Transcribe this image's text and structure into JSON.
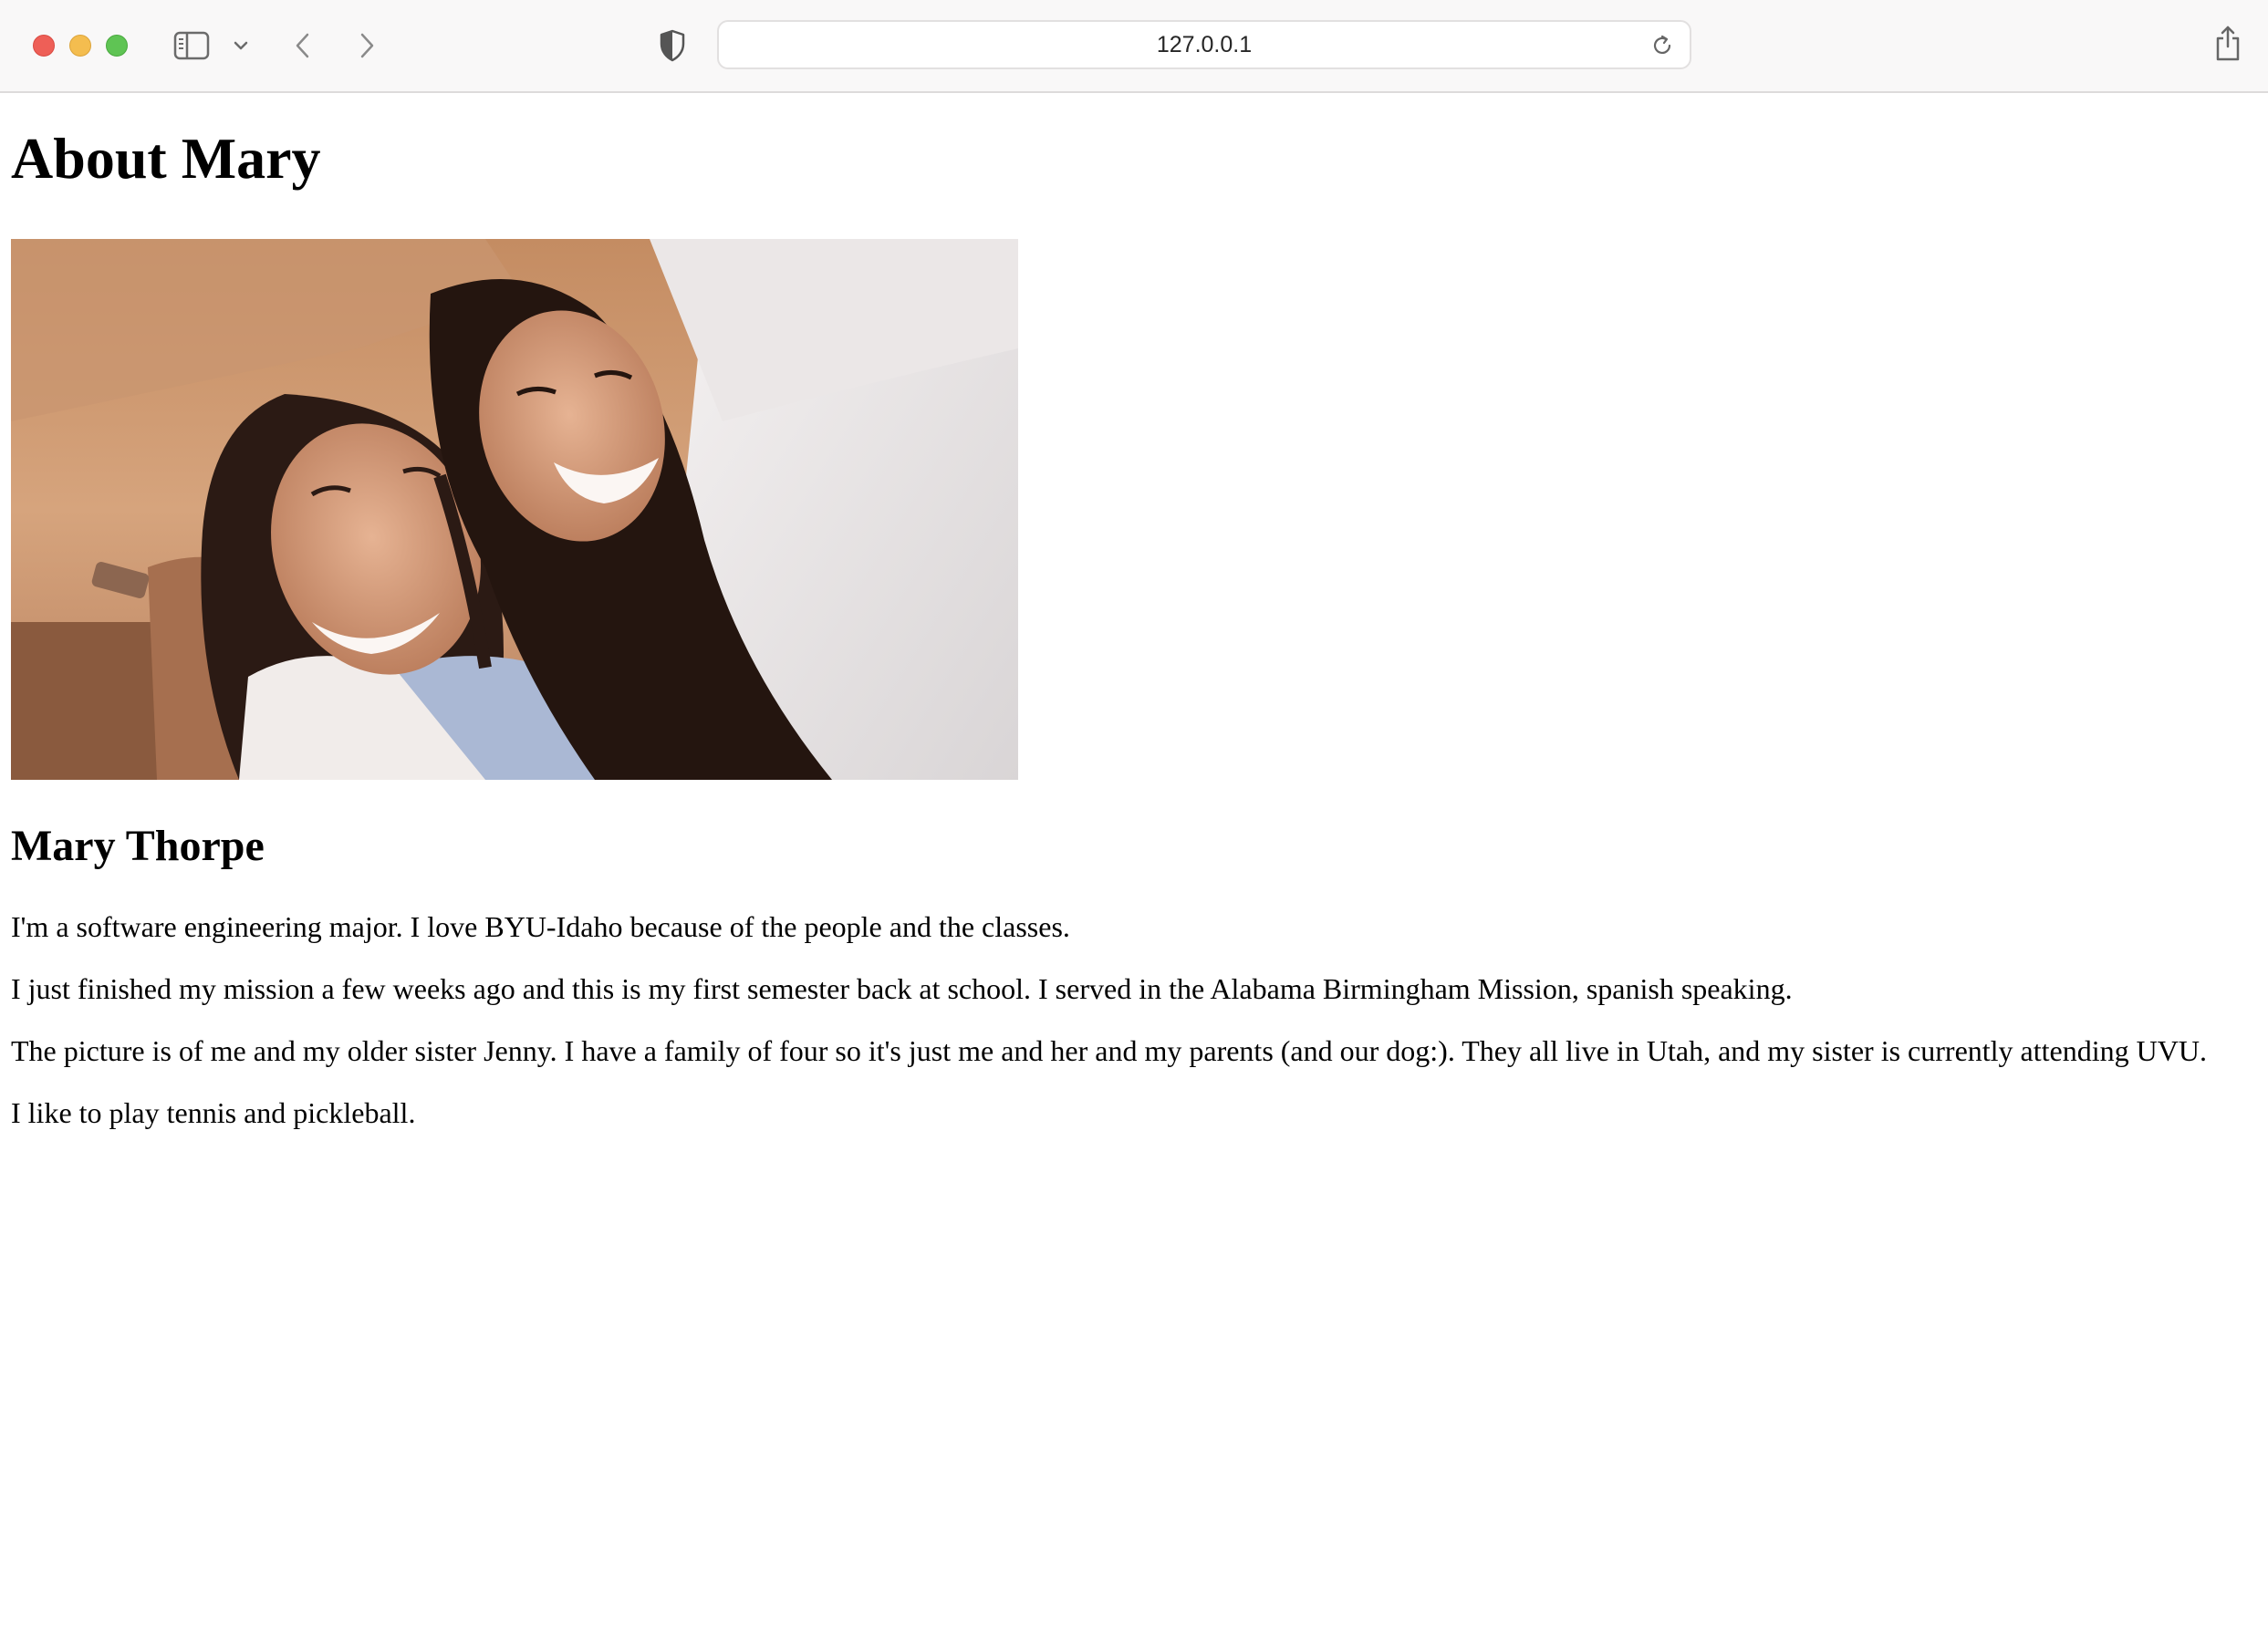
{
  "browser": {
    "url": "127.0.0.1",
    "icons": {
      "sidebar": "sidebar-icon",
      "tab_overview": "chevron-down-icon",
      "back": "chevron-left-icon",
      "forward": "chevron-right-icon",
      "privacy": "shield-icon",
      "reload": "reload-icon",
      "share": "share-icon"
    }
  },
  "page": {
    "title": "About Mary",
    "name": "Mary Thorpe",
    "paragraphs": [
      "I'm a software engineering major. I love BYU-Idaho because of the people and the classes.",
      "I just finished my mission a few weeks ago and this is my first semester back at school. I served in the Alabama Birmingham Mission, spanish speaking.",
      "The picture is of me and my older sister Jenny. I have a family of four so it's just me and her and my parents (and our dog:). They all live in Utah, and my sister is currently attending UVU.",
      "I like to play tennis and pickleball."
    ]
  },
  "colors": {
    "traffic_red": "#ee5f57",
    "traffic_yellow": "#f4bd4f",
    "traffic_green": "#5fc454",
    "toolbar_bg": "#f9f8f8"
  }
}
